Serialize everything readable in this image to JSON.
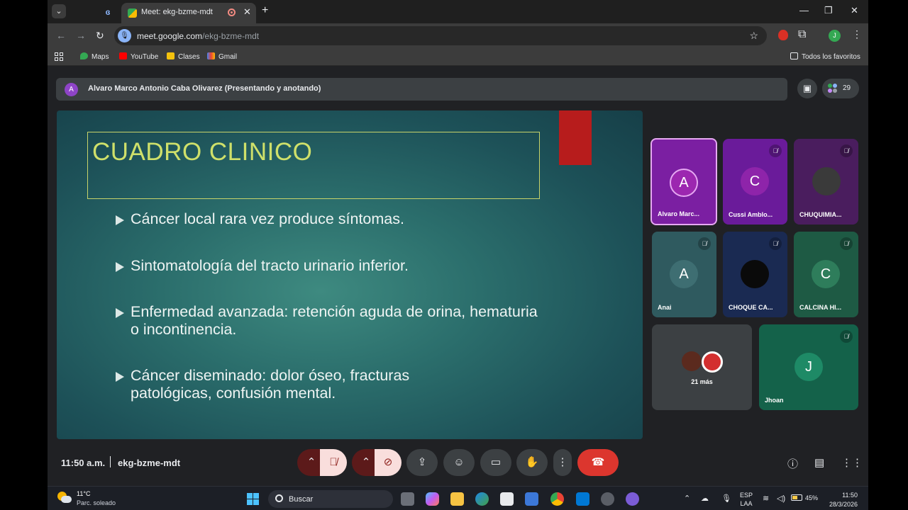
{
  "browser": {
    "tabs": [
      {
        "label": "",
        "active": false
      },
      {
        "label": "Meet: ekg-bzme-mdt",
        "active": true
      }
    ],
    "url_host": "meet.google.com",
    "url_path": "/ekg-bzme-mdt",
    "bookmarks": [
      "Maps",
      "YouTube",
      "Clases",
      "Gmail"
    ],
    "all_bookmarks_label": "Todos los favoritos",
    "profile_initial": "J"
  },
  "meet": {
    "presenter_initial": "A",
    "presenter_banner": "Alvaro Marco Antonio Caba Olivarez (Presentando y anotando)",
    "participant_count": "29",
    "slide": {
      "title": "CUADRO CLINICO",
      "bullets": [
        "Cáncer local rara vez produce síntomas.",
        "Sintomatología del tracto urinario inferior.",
        "Enfermedad avanzada: retención aguda  de orina, hematuria o incontinencia.",
        "Cáncer diseminado: dolor óseo, fracturas patológicas, confusión mental."
      ]
    },
    "tiles": [
      {
        "name": "Alvaro Marc...",
        "initial": "A",
        "muted": false
      },
      {
        "name": "Cussi Amblo...",
        "initial": "C",
        "muted": true
      },
      {
        "name": "CHUQUIMIA...",
        "initial": "",
        "muted": true
      },
      {
        "name": "Anai",
        "initial": "A",
        "muted": true
      },
      {
        "name": "CHOQUE CA...",
        "initial": "",
        "muted": true
      },
      {
        "name": "CALCINA HI...",
        "initial": "C",
        "muted": true
      },
      {
        "name": "21 más",
        "initial": "",
        "muted": false
      },
      {
        "name": "Jhoan",
        "initial": "J",
        "muted": true
      }
    ],
    "time": "11:50 a.m.",
    "meeting_code": "ekg-bzme-mdt",
    "colors": {
      "hangup": "#dc362e",
      "active_speaker_border": "#e6a8f2"
    }
  },
  "taskbar": {
    "temperature": "11°C",
    "weather": "Parc. soleado",
    "search_placeholder": "Buscar",
    "language": "ESP",
    "keyboard": "LAA",
    "battery": "45%",
    "time": "11:50",
    "date": "28/3/2026"
  }
}
